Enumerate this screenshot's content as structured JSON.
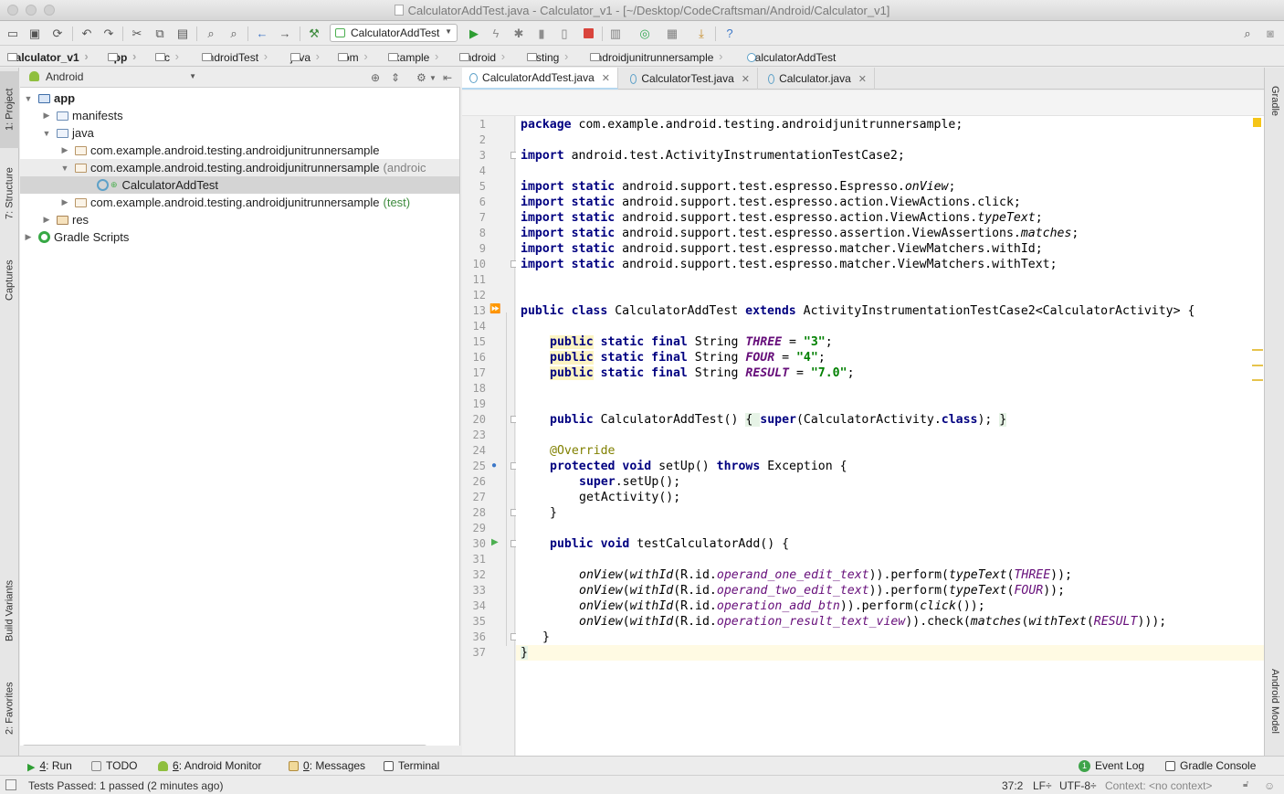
{
  "window": {
    "title": "CalculatorAddTest.java - Calculator_v1 - [~/Desktop/CodeCraftsman/Android/Calculator_v1]"
  },
  "toolbar": {
    "run_config": "CalculatorAddTest"
  },
  "breadcrumbs": [
    "Calculator_v1",
    "app",
    "src",
    "androidTest",
    "java",
    "com",
    "example",
    "android",
    "testing",
    "androidjunitrunnersample",
    "CalculatorAddTest"
  ],
  "left_tool_windows": {
    "project": "1: Project",
    "structure": "7: Structure",
    "captures": "Captures",
    "build_variants": "Build Variants",
    "favorites": "2: Favorites"
  },
  "right_tool_windows": {
    "gradle": "Gradle",
    "android_model": "Android Model"
  },
  "project_panel": {
    "view": "Android",
    "tree": [
      {
        "label": "app",
        "suffix": ""
      },
      {
        "label": "manifests",
        "suffix": ""
      },
      {
        "label": "java",
        "suffix": ""
      },
      {
        "label": "com.example.android.testing.androidjunitrunnersample",
        "suffix": ""
      },
      {
        "label": "com.example.android.testing.androidjunitrunnersample",
        "suffix": "(androic"
      },
      {
        "label": "CalculatorAddTest",
        "suffix": ""
      },
      {
        "label": "com.example.android.testing.androidjunitrunnersample",
        "suffix": "(test)"
      },
      {
        "label": "res",
        "suffix": ""
      },
      {
        "label": "Gradle Scripts",
        "suffix": ""
      }
    ]
  },
  "editor_tabs": [
    "CalculatorAddTest.java",
    "CalculatorTest.java",
    "Calculator.java"
  ],
  "editor": {
    "line_numbers": [
      "1",
      "2",
      "3",
      "4",
      "5",
      "6",
      "7",
      "8",
      "9",
      "10",
      "11",
      "12",
      "13",
      "14",
      "15",
      "16",
      "17",
      "18",
      "19",
      "20",
      "23",
      "24",
      "25",
      "26",
      "27",
      "28",
      "29",
      "30",
      "31",
      "32",
      "33",
      "34",
      "35",
      "36",
      "37"
    ],
    "code": {
      "l1_kw": "package",
      "l1_rest": " com.example.android.testing.androidjunitrunnersample;",
      "l3_kw": "import",
      "l3_rest": " android.test.ActivityInstrumentationTestCase2;",
      "import_static": "import static",
      "l5_a": " android.support.test.espresso.Espresso.",
      "l5_b": "onView",
      "l6": " android.support.test.espresso.action.ViewActions.click;",
      "l7_a": " android.support.test.espresso.action.ViewActions.",
      "l7_b": "typeText",
      "l8_a": " android.support.test.espresso.assertion.ViewAssertions.",
      "l8_b": "matches",
      "l9": " android.support.test.espresso.matcher.ViewMatchers.withId;",
      "l10": " android.support.test.espresso.matcher.ViewMatchers.withText;",
      "l13_a": "public class",
      "l13_b": " CalculatorAddTest ",
      "l13_c": "extends",
      "l13_d": " ActivityInstrumentationTestCase2<CalculatorActivity> {",
      "public": "public",
      "static_final": " static final",
      "string_type": " String ",
      "three": "THREE",
      "three_val": "\"3\"",
      "four": "FOUR",
      "four_val": "\"4\"",
      "result": "RESULT",
      "result_val": "\"7.0\"",
      "l20_a": " CalculatorAddTest() ",
      "l20_b": "{ ",
      "l20_c": "super",
      "l20_d": "(CalculatorActivity.",
      "l20_e": "class",
      "l20_f": "); ",
      "l20_g": "}",
      "l24": "@Override",
      "l25_a": "protected void",
      "l25_b": " setUp() ",
      "l25_c": "throws",
      "l25_d": " Exception {",
      "l26_a": "super",
      "l26_b": ".setUp();",
      "l27": "getActivity();",
      "close": "}",
      "l30_a": "public void",
      "l30_b": " testCalculatorAdd() {",
      "l32_a": "onView",
      "l32_b": "(",
      "l32_c": "withId",
      "l32_d": "(R.id.",
      "l32_e": "operand_one_edit_text",
      "l32_f": ")).perform(",
      "l32_g": "typeText",
      "l32_h": "(",
      "l32_i": "THREE",
      "l32_j": "));",
      "l33_e": "operand_two_edit_text",
      "l33_i": "FOUR",
      "l34_e": "operation_add_btn",
      "l34_f": ")).perform(",
      "l34_g": "click",
      "l34_h": "());",
      "l35_e": "operation_result_text_view",
      "l35_f": ")).check(",
      "l35_g": "matches",
      "l35_h": "(",
      "l35_i": "withText",
      "l35_k": "RESULT",
      "l35_j": ")));",
      "semi": ";",
      "eq": " = ",
      "comma": " "
    }
  },
  "bottom_tools": [
    {
      "num": "4",
      "label": ": Run"
    },
    {
      "num": "",
      "label": "TODO"
    },
    {
      "num": "6",
      "label": ": Android Monitor"
    },
    {
      "num": "0",
      "label": ": Messages"
    },
    {
      "num": "",
      "label": "Terminal"
    }
  ],
  "right_bottom_tools": {
    "event_log": "Event Log",
    "event_log_count": "1",
    "gradle_console": "Gradle Console"
  },
  "status": {
    "message": "Tests Passed: 1 passed (2 minutes ago)",
    "position": "37:2",
    "line_sep": "LF÷",
    "encoding": "UTF-8÷",
    "context": "Context: <no context>"
  },
  "colors": {
    "keyword": "#000080",
    "string": "#008000",
    "field": "#660e7a",
    "annotation": "#808000"
  }
}
